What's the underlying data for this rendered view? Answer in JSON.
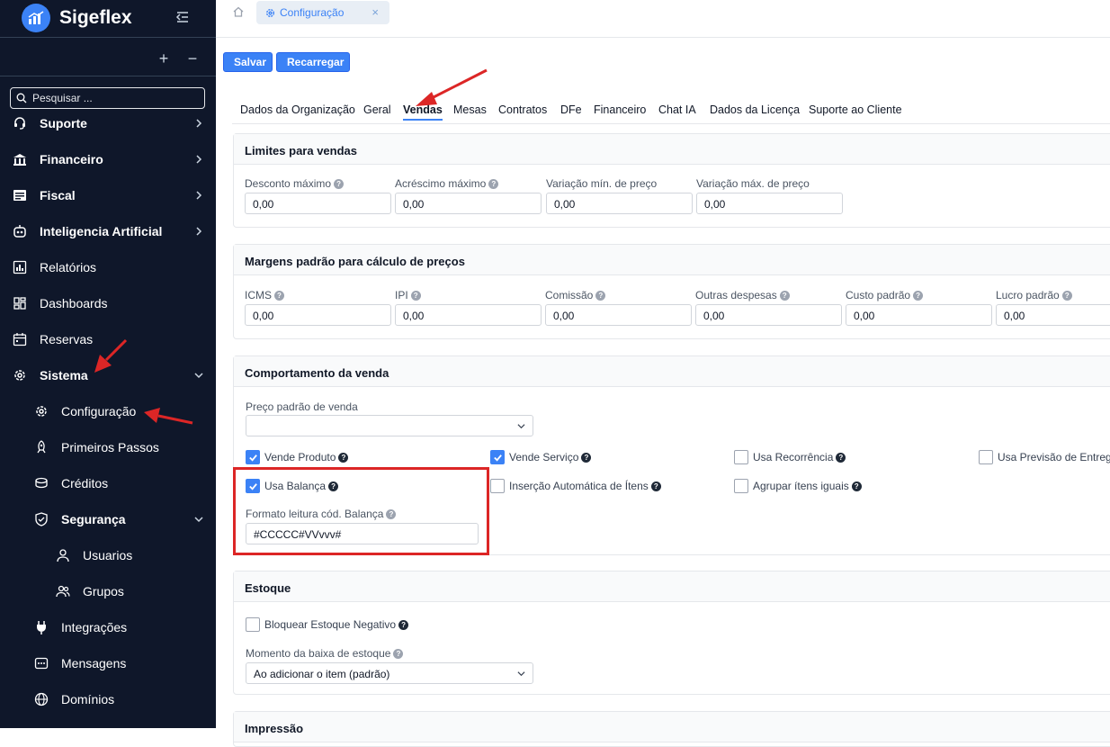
{
  "app": {
    "name": "Sigeflex"
  },
  "sidebar": {
    "search_placeholder": "Pesquisar ...",
    "plus": "+",
    "minus": "−",
    "items": [
      {
        "label": "Suporte",
        "icon": "headset-icon"
      },
      {
        "label": "Financeiro",
        "icon": "bank-icon"
      },
      {
        "label": "Fiscal",
        "icon": "fiscal-icon"
      },
      {
        "label": "Inteligencia Artificial",
        "icon": "ai-icon"
      },
      {
        "label": "Relatórios",
        "icon": "report-icon"
      },
      {
        "label": "Dashboards",
        "icon": "dashboard-icon"
      },
      {
        "label": "Reservas",
        "icon": "calendar-icon"
      },
      {
        "label": "Sistema",
        "icon": "gear-icon"
      },
      {
        "label": "Configuração",
        "icon": "gear-icon"
      },
      {
        "label": "Primeiros Passos",
        "icon": "rocket-icon"
      },
      {
        "label": "Créditos",
        "icon": "coins-icon"
      },
      {
        "label": "Segurança",
        "icon": "shield-icon"
      },
      {
        "label": "Usuarios",
        "icon": "user-icon"
      },
      {
        "label": "Grupos",
        "icon": "group-icon"
      },
      {
        "label": "Integrações",
        "icon": "plug-icon"
      },
      {
        "label": "Mensagens",
        "icon": "message-icon"
      },
      {
        "label": "Domínios",
        "icon": "globe-icon"
      }
    ]
  },
  "topbar": {
    "tab_label": "Configuração",
    "tab_close": "×"
  },
  "toolbar": {
    "save_label": "Salvar",
    "reload_label": "Recarregar"
  },
  "tabs": [
    "Dados da Organização",
    "Geral",
    "Vendas",
    "Mesas",
    "Contratos",
    "DFe",
    "Financeiro",
    "Chat IA",
    "Dados da Licença",
    "Suporte ao Cliente"
  ],
  "active_tab": "Vendas",
  "limits": {
    "title": "Limites para vendas",
    "fields": [
      {
        "label": "Desconto máximo",
        "value": "0,00",
        "help": true
      },
      {
        "label": "Acréscimo máximo",
        "value": "0,00",
        "help": true
      },
      {
        "label": "Variação mín. de preço",
        "value": "0,00",
        "help": false
      },
      {
        "label": "Variação máx. de preço",
        "value": "0,00",
        "help": false
      }
    ]
  },
  "margins": {
    "title": "Margens padrão para cálculo de preços",
    "fields": [
      {
        "label": "ICMS",
        "value": "0,00"
      },
      {
        "label": "IPI",
        "value": "0,00"
      },
      {
        "label": "Comissão",
        "value": "0,00"
      },
      {
        "label": "Outras despesas",
        "value": "0,00"
      },
      {
        "label": "Custo padrão",
        "value": "0,00"
      },
      {
        "label": "Lucro padrão",
        "value": "0,00"
      }
    ]
  },
  "behavior": {
    "title": "Comportamento da venda",
    "price_label": "Preço padrão de venda",
    "price_value": "",
    "checks": [
      {
        "label": "Vende Produto",
        "checked": true
      },
      {
        "label": "Vende Serviço",
        "checked": true
      },
      {
        "label": "Usa Recorrência",
        "checked": false
      },
      {
        "label": "Usa Previsão de Entrega",
        "checked": false
      },
      {
        "label": "Usa Balança",
        "checked": true
      },
      {
        "label": "Inserção Automática de Ítens",
        "checked": false
      },
      {
        "label": "Agrupar ítens iguais",
        "checked": false
      }
    ],
    "scale_format_label": "Formato leitura cód. Balança",
    "scale_format_value": "#CCCCC#VVvvv#"
  },
  "stock": {
    "title": "Estoque",
    "block_negative_label": "Bloquear Estoque Negativo",
    "block_negative_checked": false,
    "moment_label": "Momento da baixa de estoque",
    "moment_value": "Ao adicionar o item (padrão)"
  },
  "print": {
    "title": "Impressão"
  },
  "colors": {
    "sidebar_bg": "#0f172a",
    "accent": "#3b82f6",
    "annotation": "#dc2626"
  }
}
